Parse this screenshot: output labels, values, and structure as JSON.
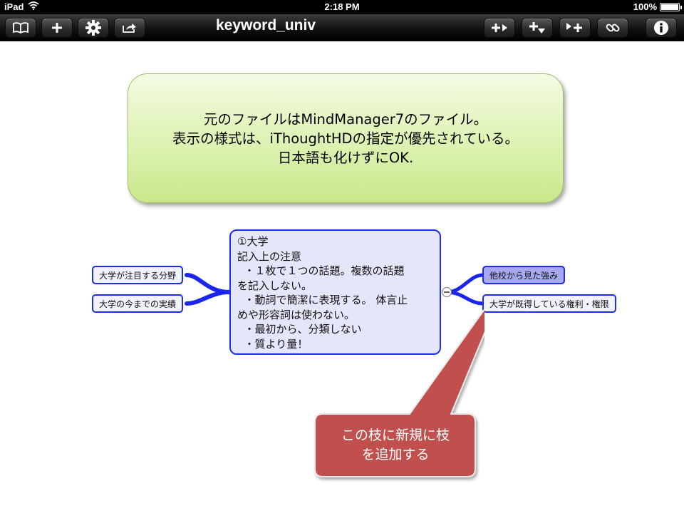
{
  "status_bar": {
    "device": "iPad",
    "time": "2:18 PM",
    "battery_text": "100%",
    "battery_level": 1.0
  },
  "toolbar": {
    "title": "keyword_univ",
    "left_buttons": [
      "book-icon",
      "plus-icon",
      "gear-icon",
      "share-icon"
    ],
    "right_buttons": [
      "add-sibling-icon",
      "add-child-icon",
      "add-topic-icon",
      "link-icon",
      "info-icon"
    ]
  },
  "note": {
    "lines": [
      "元のファイルはMindManager7のファイル。",
      "表示の様式は、iThoughtHDの指定が優先されている。",
      "日本語も化けずにOK."
    ]
  },
  "central_topic": {
    "lines": [
      "①大学",
      "記入上の注意",
      "  ・１枚で１つの話題。複数の話題",
      "を記入しない。",
      "  ・動詞で簡潔に表現する。 体言止",
      "めや形容詞は使わない。",
      "  ・最初から、分類しない",
      "  ・質より量！"
    ]
  },
  "left_topics": [
    "大学が注目する分野",
    "大学の今までの実績"
  ],
  "right_topics": [
    "他校から見た強み",
    "大学が既得している権利・権限"
  ],
  "callout": {
    "lines": [
      "この枝に新規に枝",
      "を追加する"
    ]
  },
  "colors": {
    "branch": "#1a26ee",
    "topic_border": "#1d2de8",
    "central_fill": "#e6e6fb",
    "selected_fill": "#a8a8f0",
    "callout_fill": "#c0504d",
    "note_fill": "#d9f0a8"
  }
}
